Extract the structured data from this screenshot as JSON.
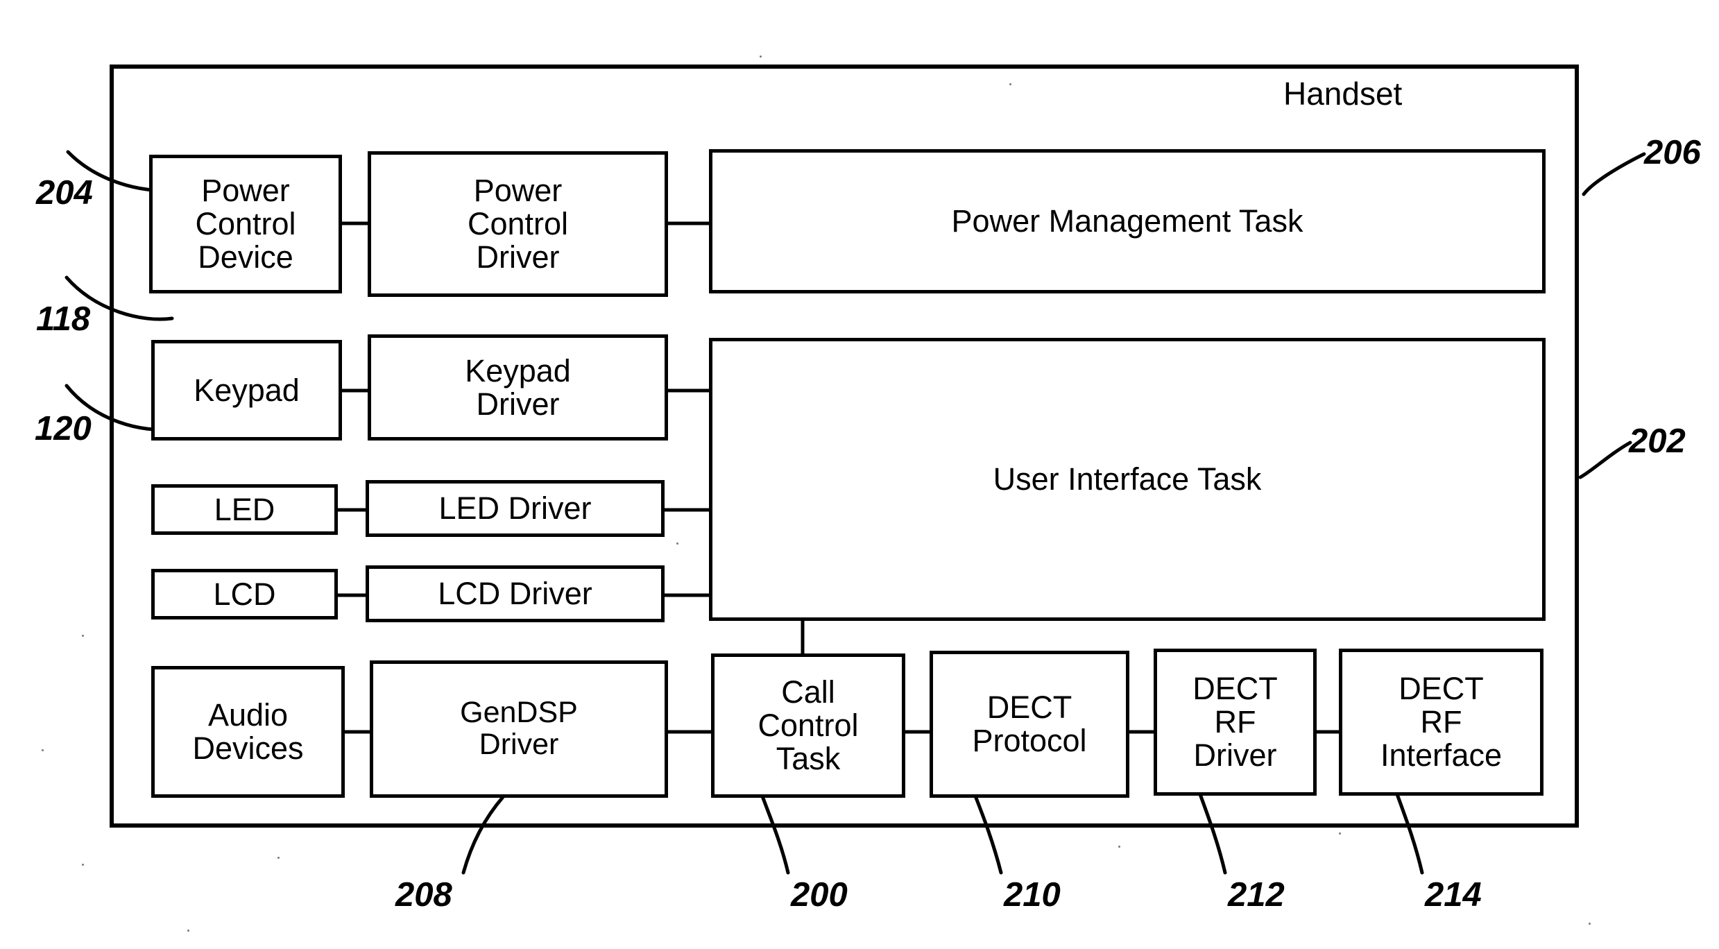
{
  "figure": {
    "type": "patent-block-diagram",
    "container_label": "Handset",
    "background_color": "#ffffff",
    "line_color": "#000000"
  },
  "blocks": {
    "power_control_device": "Power\nControl\nDevice",
    "power_control_driver": "Power\nControl\nDriver",
    "power_management_task": "Power Management Task",
    "keypad": "Keypad",
    "keypad_driver": "Keypad\nDriver",
    "led": "LED",
    "led_driver": "LED Driver",
    "lcd": "LCD",
    "lcd_driver": "LCD Driver",
    "user_interface_task": "User Interface Task",
    "audio_devices": "Audio\nDevices",
    "gendsp_driver": "GenDSP\nDriver",
    "call_control_task": "Call\nControl\nTask",
    "dect_protocol": "DECT\nProtocol",
    "dect_rf_driver": "DECT\nRF\nDriver",
    "dect_rf_interface": "DECT\nRF\nInterface"
  },
  "reference_numerals": {
    "n204": "204",
    "n118": "118",
    "n120": "120",
    "n206": "206",
    "n202": "202",
    "n208": "208",
    "n200": "200",
    "n210": "210",
    "n212": "212",
    "n214": "214"
  }
}
